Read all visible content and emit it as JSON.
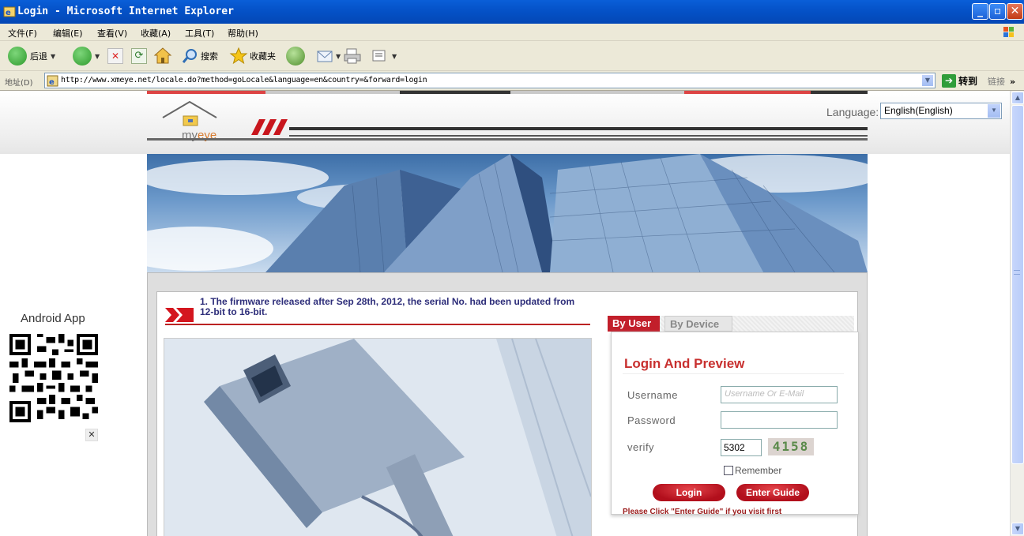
{
  "window": {
    "title": "Login - Microsoft Internet Explorer"
  },
  "menu": [
    "文件(F)",
    "编辑(E)",
    "查看(V)",
    "收藏(A)",
    "工具(T)",
    "帮助(H)"
  ],
  "toolbar": {
    "back_label": "后退",
    "search_label": "搜索",
    "favorites_label": "收藏夹"
  },
  "address": {
    "label": "地址(D)",
    "url": "http://www.xmeye.net/locale.do?method=goLocale&language=en&country=&forward=login",
    "go_label": "转到",
    "links_label": "链接"
  },
  "page": {
    "logo_text_prefix": "my",
    "logo_text_suffix": "eye",
    "language_label": "Language:",
    "language_value": "English(English)",
    "notice": "1. The firmware released after Sep 28th, 2012, the serial No. had been updated from 12-bit to 16-bit.",
    "tabs": [
      {
        "label": "By User",
        "active": true
      },
      {
        "label": "By Device",
        "active": false
      }
    ],
    "login": {
      "title": "Login And Preview",
      "username_label": "Username",
      "username_placeholder": "Username Or E-Mail",
      "password_label": "Password",
      "verify_label": "verify",
      "verify_value": "5302",
      "captcha": "4158",
      "remember_label": "Remember",
      "login_button": "Login",
      "guide_button": "Enter Guide",
      "hint": "Please Click \"Enter Guide\" if you visit first"
    },
    "android_label": "Android App"
  },
  "colors": {
    "brand_red": "#c21f2b",
    "xp_blue": "#0553c9"
  }
}
